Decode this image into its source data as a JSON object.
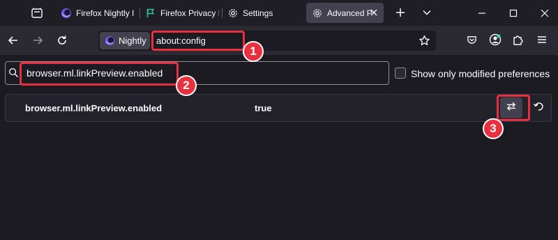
{
  "tabs": [
    {
      "label": "Firefox Nightly I",
      "icon": "nightly-logo-icon"
    },
    {
      "label": "Firefox Privacy I",
      "icon": "flag-icon"
    },
    {
      "label": "Settings",
      "icon": "gear-icon"
    },
    {
      "label": "Advanced Pr",
      "icon": "gear-icon",
      "active": true
    }
  ],
  "urlbar": {
    "identity_label": "Nightly",
    "url": "about:config"
  },
  "config": {
    "search_value": "browser.ml.linkPreview.enabled",
    "modified_only_label": "Show only modified preferences",
    "modified_only_checked": false,
    "preference": {
      "name": "browser.ml.linkPreview.enabled",
      "value": "true"
    }
  },
  "annotations": [
    "1",
    "2",
    "3"
  ],
  "colors": {
    "background": "#1c1b22",
    "toolbar": "#2b2a33",
    "annotation": "#e8303e",
    "text": "#fbfbfe"
  }
}
